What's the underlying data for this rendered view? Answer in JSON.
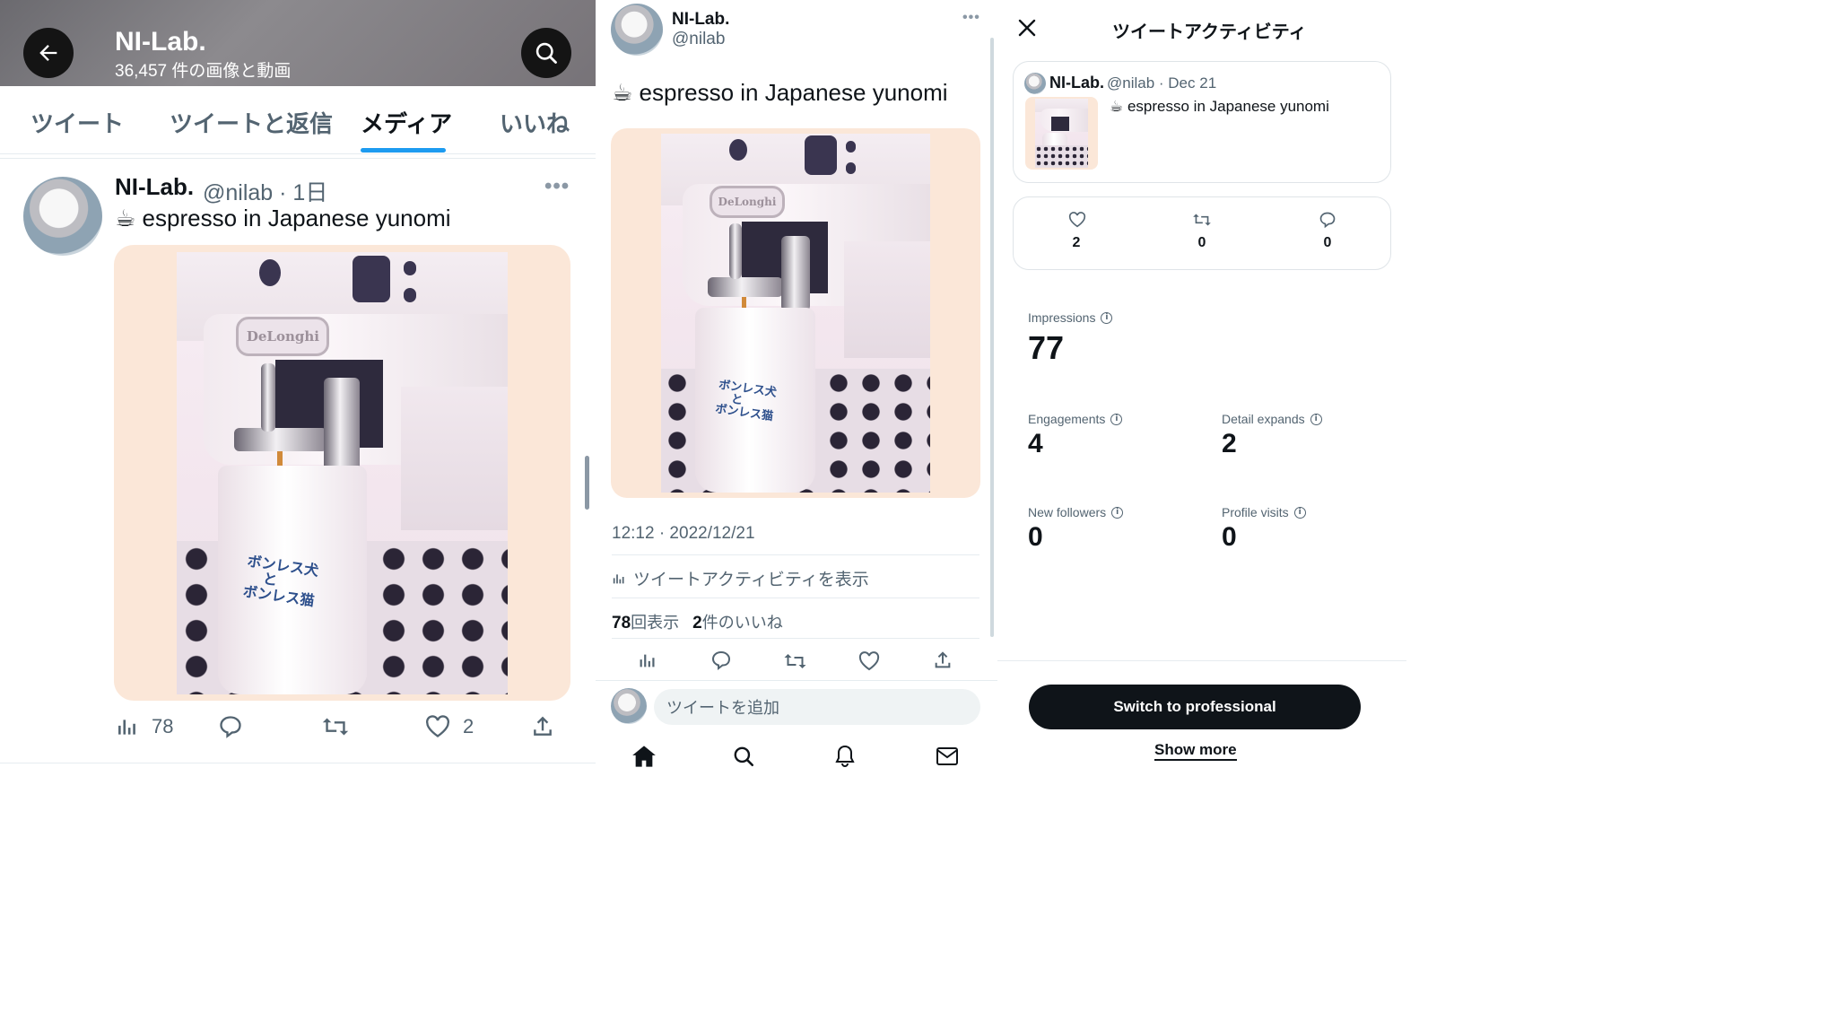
{
  "left": {
    "header": {
      "name": "NI-Lab.",
      "subtitle": "36,457 件の画像と動画"
    },
    "tabs": [
      "ツイート",
      "ツイートと返信",
      "メディア",
      "いいね"
    ],
    "active_tab": "メディア",
    "tweet": {
      "name": "NI-Lab.",
      "handle_time": "@nilab · 1日",
      "text": "☕ espresso in Japanese yunomi",
      "views": "78",
      "likes": "2"
    }
  },
  "middle": {
    "name": "NI-Lab.",
    "handle": "@nilab",
    "text": "☕ espresso in Japanese yunomi",
    "timestamp": "12:12 · 2022/12/21",
    "activity_link": "ツイートアクティビティを表示",
    "views_count": "78",
    "views_label": "回表示",
    "likes_count": "2",
    "likes_label": "件のいいね",
    "reply_placeholder": "ツイートを追加"
  },
  "right": {
    "title": "ツイートアクティビティ",
    "card": {
      "name": "NI-Lab.",
      "handle_date": "@nilab · Dec 21",
      "text": "☕ espresso in Japanese yunomi"
    },
    "counts": {
      "likes": "2",
      "retweets": "0",
      "replies": "0"
    },
    "metrics": {
      "impressions_label": "Impressions",
      "impressions": "77",
      "engagements_label": "Engagements",
      "engagements": "4",
      "detail_label": "Detail expands",
      "detail": "2",
      "followers_label": "New followers",
      "followers": "0",
      "profile_label": "Profile visits",
      "profile": "0"
    },
    "pro_button": "Switch to professional",
    "show_more": "Show more"
  },
  "photo_text": {
    "brand": "DeLonghi",
    "cup_line1": "ボンレス犬",
    "cup_line2": "と",
    "cup_line3": "ボンレス猫"
  },
  "colors": {
    "accent": "#1d9bf0",
    "photo_backdrop": "#fbe7d8",
    "dark_button": "#0f1419"
  }
}
